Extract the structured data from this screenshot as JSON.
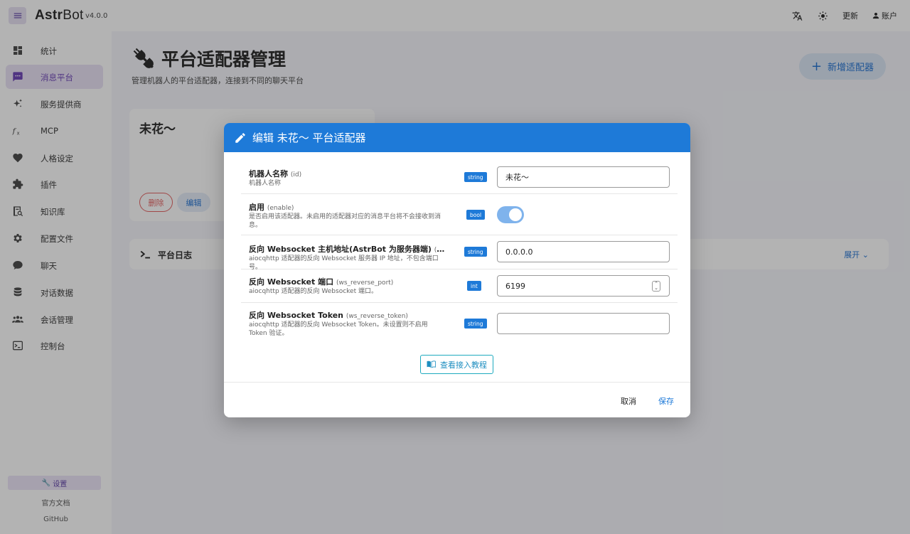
{
  "app": {
    "name_prefix": "Astr",
    "name_suffix": "Bot",
    "version": "v4.0.0"
  },
  "topbar": {
    "update_label": "更新",
    "account_label": "账户",
    "icons": [
      "translate-icon",
      "brightness-icon",
      "person-icon"
    ]
  },
  "sidebar": {
    "items": [
      {
        "label": "统计",
        "icon": "dashboard-icon"
      },
      {
        "label": "消息平台",
        "icon": "message-icon",
        "active": true
      },
      {
        "label": "服务提供商",
        "icon": "sparkle-icon"
      },
      {
        "label": "MCP",
        "icon": "function-icon"
      },
      {
        "label": "人格设定",
        "icon": "heart-icon"
      },
      {
        "label": "插件",
        "icon": "puzzle-icon"
      },
      {
        "label": "知识库",
        "icon": "book-search-icon"
      },
      {
        "label": "配置文件",
        "icon": "gear-icon"
      },
      {
        "label": "聊天",
        "icon": "chat-icon"
      },
      {
        "label": "对话数据",
        "icon": "database-icon"
      },
      {
        "label": "会话管理",
        "icon": "people-icon"
      },
      {
        "label": "控制台",
        "icon": "terminal-icon"
      }
    ],
    "settings_label": "设置",
    "docs_label": "官方文档",
    "github_label": "GitHub"
  },
  "page": {
    "title": "平台适配器管理",
    "subtitle": "管理机器人的平台适配器，连接到不同的聊天平台",
    "add_button": "新增适配器",
    "card": {
      "name": "未花～",
      "delete_label": "删除",
      "edit_label": "编辑"
    },
    "log": {
      "title": "平台日志",
      "expand_label": "展开"
    }
  },
  "dialog": {
    "title": "编辑 未花～ 平台适配器",
    "fields": [
      {
        "label": "机器人名称",
        "key": "(id)",
        "desc": "机器人名称",
        "type": "string",
        "value": "未花～"
      },
      {
        "label": "启用",
        "key": "(enable)",
        "desc": "是否启用该适配器。未启用的适配器对应的消息平台将不会接收到消息。",
        "type": "bool",
        "value": "true"
      },
      {
        "label": "反向 Websocket 主机地址(AstrBot 为服务器端)",
        "key": "(ws_reverse_host)",
        "desc": "aiocqhttp 适配器的反向 Websocket 服务器 IP 地址，不包含端口号。",
        "type": "string",
        "value": "0.0.0.0"
      },
      {
        "label": "反向 Websocket 端口",
        "key": "(ws_reverse_port)",
        "desc": "aiocqhttp 适配器的反向 Websocket 端口。",
        "type": "int",
        "value": "6199"
      },
      {
        "label": "反向 Websocket Token",
        "key": "(ws_reverse_token)",
        "desc": "aiocqhttp 适配器的反向 Websocket Token。未设置则不启用 Token 验证。",
        "type": "string",
        "value": ""
      }
    ],
    "tutorial_button": "查看接入教程",
    "cancel_label": "取消",
    "save_label": "保存"
  },
  "colors": {
    "primary": "#1e7ad8",
    "accent": "#6a3fb5",
    "danger": "#e35d5d"
  }
}
